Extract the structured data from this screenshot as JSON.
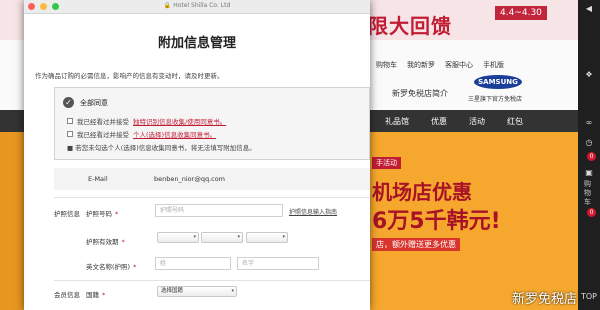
{
  "background_page": {
    "promo_title": "限大回馈",
    "promo_sub": "4.4~4.30",
    "top_links": [
      "购物车",
      "我的新罗",
      "客服中心",
      "手机版"
    ],
    "store_intro": "新罗免税店简介",
    "samsung_logo": "SAMSUNG",
    "samsung_sub": "三星旗下官方免税店",
    "nav_items": [
      "礼品馆",
      "优惠",
      "活动",
      "红包"
    ],
    "banner_tag": "手活动",
    "banner_line1": "机场店优惠",
    "banner_line2": "6万5千韩元!",
    "banner_note": "店，额外赠送更多优惠",
    "watermark": "新罗免税店"
  },
  "right_sidebar": {
    "badges": [
      "0",
      "0"
    ],
    "vertical_labels": [
      "购物车",
      "TOP"
    ]
  },
  "dialog": {
    "url": "Hotel Shilla Co. Ltd",
    "title": "附加信息管理",
    "description": "作为确品订购的必需信息，影响产的信息有变动时，请及时更新。",
    "agree_all_label": "全部同意",
    "consent_rows": [
      {
        "text": "我已经看过并接受",
        "link": "独特识别信息收集/使用同意书。"
      },
      {
        "text": "我已经看过并接受",
        "link": "个人(选择)信息收集同意书。"
      }
    ],
    "note": "若您未勾选个人(选择)信息收集同意书，将无法填写附加信息。",
    "email": {
      "label": "E-Mail",
      "value": "benben_nior@qq.com"
    },
    "passport_section": "护照信息",
    "passport_number": {
      "label": "护照号码",
      "placeholder": "护照号码"
    },
    "passport_help": "护照信息输入指南",
    "passport_expiry": {
      "label": "护照有效期"
    },
    "english_name": {
      "label": "英文名称(护照)",
      "surname_placeholder": "姓",
      "given_placeholder": "名字"
    },
    "member_section": "会员信息",
    "nationality": {
      "label": "国籍",
      "selected": "选择国籍"
    }
  },
  "colors": {
    "accent": "#c21c35",
    "banner": "#f6a72d"
  }
}
